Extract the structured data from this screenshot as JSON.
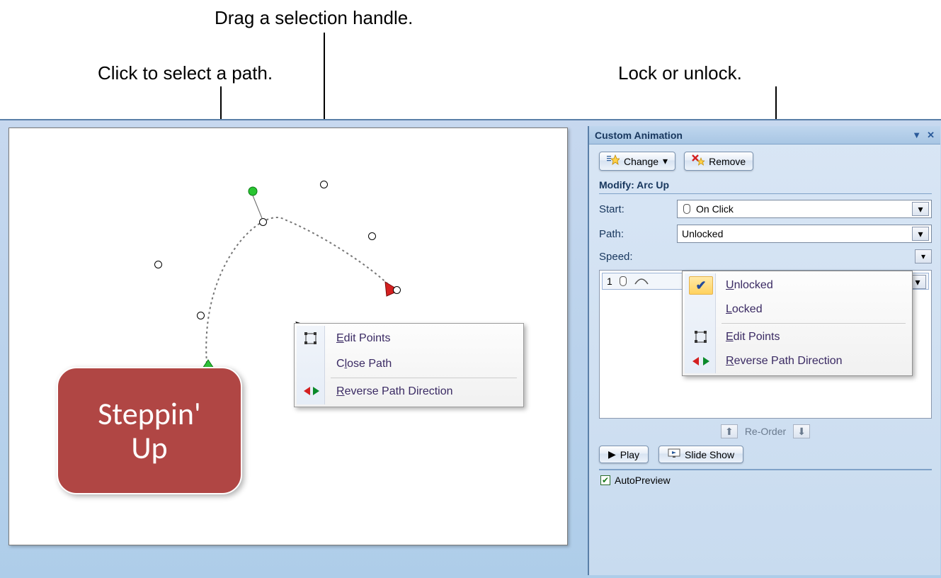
{
  "callouts": {
    "drag_handle": "Drag a selection handle.",
    "click_path": "Click to select a path.",
    "lock_unlock": "Lock or unlock."
  },
  "shape_text": "Steppin'\nUp",
  "context_menu": {
    "edit_points": "Edit Points",
    "close_path": "Close Path",
    "reverse": "Reverse Path Direction"
  },
  "pane": {
    "title": "Custom Animation",
    "change_btn": "Change",
    "remove_btn": "Remove",
    "modify_header": "Modify: Arc Up",
    "labels": {
      "start": "Start:",
      "path": "Path:",
      "speed": "Speed:"
    },
    "start_value": "On Click",
    "path_value": "Unlocked",
    "effect_index": "1",
    "reorder": "Re-Order",
    "play": "Play",
    "slideshow": "Slide Show",
    "autopreview": "AutoPreview"
  },
  "path_dropdown": {
    "unlocked": "Unlocked",
    "locked": "Locked",
    "edit_points": "Edit Points",
    "reverse": "Reverse Path Direction"
  }
}
